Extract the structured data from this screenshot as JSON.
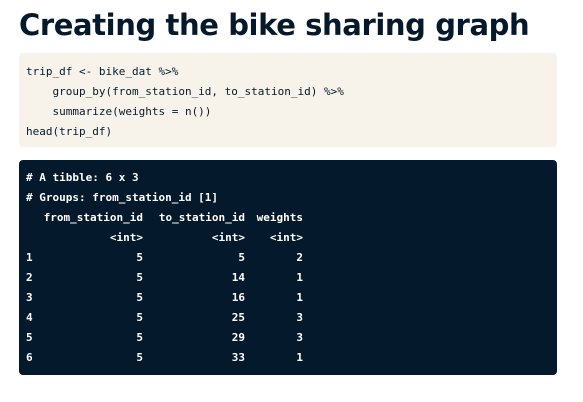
{
  "title": "Creating the bike sharing graph",
  "code": {
    "lines": [
      "trip_df <- bike_dat %>%",
      "    group_by(from_station_id, to_station_id) %>%",
      "    summarize(weights = n())",
      "head(trip_df)"
    ]
  },
  "output": {
    "tibble_line": "# A tibble: 6 x 3",
    "groups_line": "# Groups: from_station_id [1]",
    "columns": [
      "from_station_id",
      "to_station_id",
      "weights"
    ],
    "types": [
      "<int>",
      "<int>",
      "<int>"
    ],
    "rows": [
      {
        "idx": "1",
        "from": "5",
        "to": "5",
        "weights": "2"
      },
      {
        "idx": "2",
        "from": "5",
        "to": "14",
        "weights": "1"
      },
      {
        "idx": "3",
        "from": "5",
        "to": "16",
        "weights": "1"
      },
      {
        "idx": "4",
        "from": "5",
        "to": "25",
        "weights": "3"
      },
      {
        "idx": "5",
        "from": "5",
        "to": "29",
        "weights": "3"
      },
      {
        "idx": "6",
        "from": "5",
        "to": "33",
        "weights": "1"
      }
    ]
  },
  "colors": {
    "title": "#05192d",
    "code_background": "#f7f3eb",
    "output_background": "#05192d",
    "output_text": "#ffffff"
  }
}
